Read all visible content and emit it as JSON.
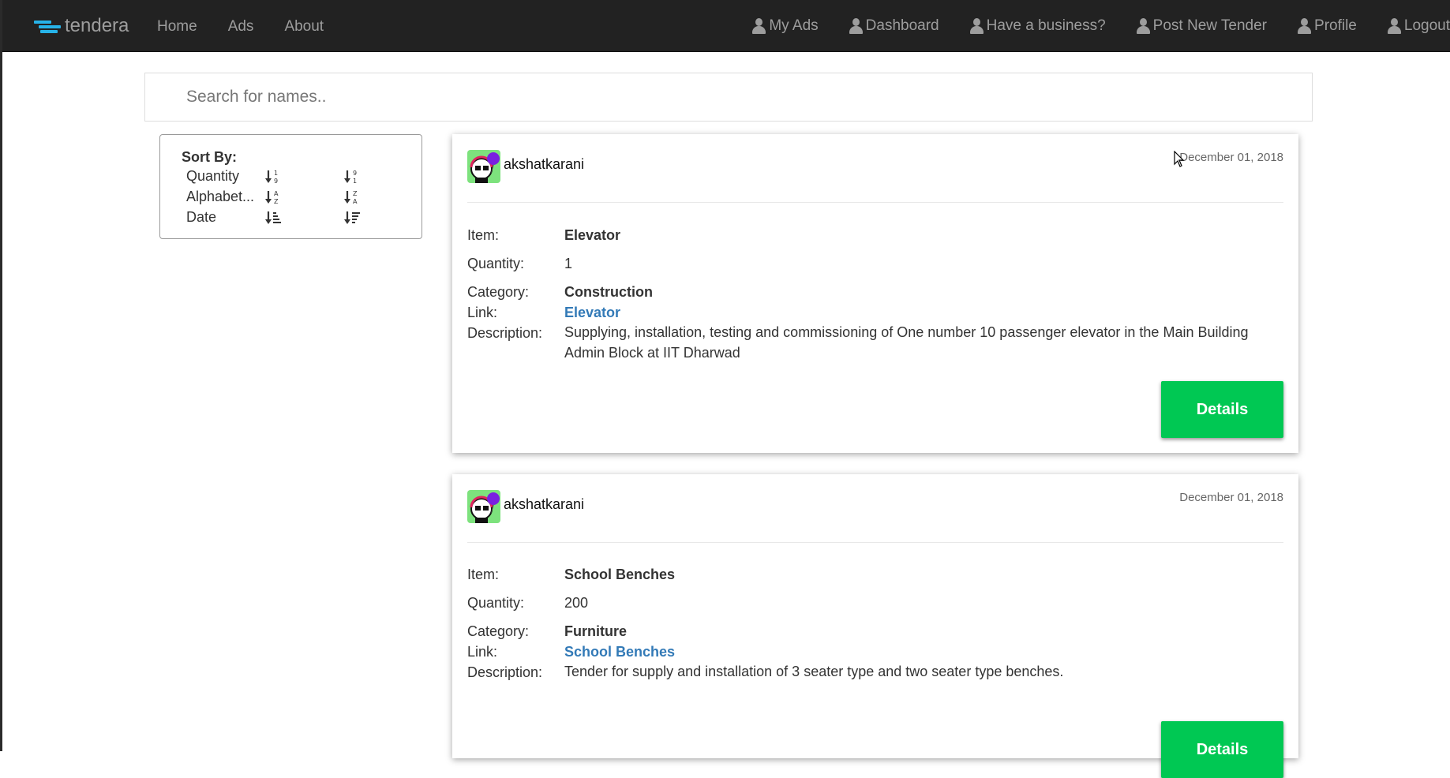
{
  "nav": {
    "brand": "tendera",
    "left": [
      "Home",
      "Ads",
      "About"
    ],
    "right": [
      "My Ads",
      "Dashboard",
      "Have a business?",
      "Post New Tender",
      "Profile",
      "Logout"
    ]
  },
  "search": {
    "placeholder": "Search for names.."
  },
  "sort": {
    "title": "Sort By:",
    "rows": [
      "Quantity",
      "Alphabet...",
      "Date"
    ]
  },
  "tenders": [
    {
      "user": "akshatkarani",
      "date": "December 01, 2018",
      "item_label": "Item:",
      "item": "Elevator",
      "quantity_label": "Quantity:",
      "quantity": "1",
      "category_label": "Category:",
      "category": "Construction",
      "link_label": "Link:",
      "link": "Elevator",
      "description_label": "Description:",
      "description": "Supplying, installation, testing and commissioning of One number 10 passenger elevator in the Main Building Admin Block at IIT Dharwad",
      "button": "Details"
    },
    {
      "user": "akshatkarani",
      "date": "December 01, 2018",
      "item_label": "Item:",
      "item": "School Benches",
      "quantity_label": "Quantity:",
      "quantity": "200",
      "category_label": "Category:",
      "category": "Furniture",
      "link_label": "Link:",
      "link": "School Benches",
      "description_label": "Description:",
      "description": "Tender for supply and installation of 3 seater type and two seater type benches.",
      "button": "Details"
    }
  ],
  "colors": {
    "navbar": "#222222",
    "accent": "#27b3e8",
    "details_button": "#00c853",
    "link": "#337ab7"
  }
}
